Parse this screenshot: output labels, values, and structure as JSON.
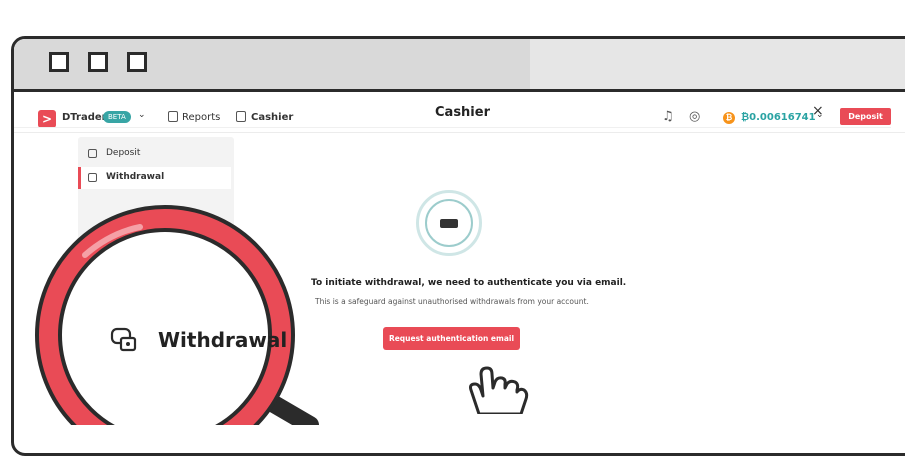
{
  "nav": {
    "brand": "DTrader",
    "beta_badge": "BETA",
    "reports": "Reports",
    "cashier": "Cashier",
    "balance": "₿0.00616741",
    "deposit_button": "Deposit"
  },
  "header": {
    "title": "Cashier",
    "close": "×"
  },
  "sidebar": {
    "items": [
      {
        "label": "Deposit"
      },
      {
        "label": "Withdrawal"
      }
    ]
  },
  "main": {
    "auth_title": "To initiate withdrawal, we need to authenticate you via email.",
    "auth_subtitle": "This is a safeguard against unauthorised withdrawals from your account.",
    "request_button": "Request authentication email"
  },
  "magnifier": {
    "label": "Withdrawal"
  },
  "colors": {
    "accent": "#e94b56",
    "teal": "#2aa3a3",
    "bitcoin": "#f7931a"
  }
}
